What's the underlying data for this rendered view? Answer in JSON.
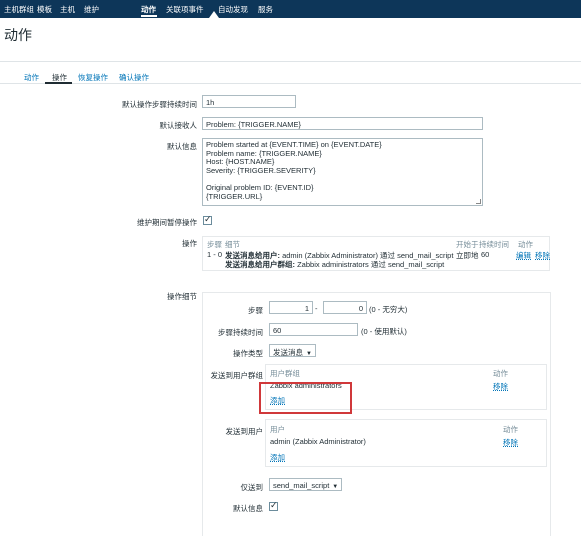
{
  "topnav": {
    "items": [
      "主机群组",
      "模板",
      "主机",
      "维护",
      "动作",
      "关联项事件",
      "自动发现",
      "服务"
    ],
    "active_index": 4
  },
  "page": {
    "title": "动作"
  },
  "tabs": {
    "items": [
      "动作",
      "操作",
      "恢复操作",
      "确认操作"
    ],
    "active_index": 1
  },
  "form": {
    "default_duration_label": "默认操作步骤持续时间",
    "default_duration_value": "1h",
    "default_subject_label": "默认接收人",
    "default_subject_value": "Problem: {TRIGGER.NAME}",
    "default_message_label": "默认信息",
    "default_message_lines": [
      "Problem started at {EVENT.TIME} on {EVENT.DATE}",
      "Problem name: {TRIGGER.NAME}",
      "Host: {HOST.NAME}",
      "Severity: {TRIGGER.SEVERITY}",
      "",
      "Original problem ID: {EVENT.ID}",
      "{TRIGGER.URL}"
    ],
    "pause_label": "维护期间暂停操作",
    "pause_checked": true
  },
  "operations": {
    "label": "操作",
    "headers": {
      "steps": "步骤",
      "details": "细节",
      "start_in": "开始于",
      "duration": "持续时间",
      "action": "动作"
    },
    "row": {
      "steps": "1 - 0",
      "line1_bold": "发送消息给用户:",
      "line1_rest": "admin (Zabbix Administrator) 通过 send_mail_script",
      "line2_bold": "发送消息给用户群组:",
      "line2_rest": "Zabbix administrators 通过 send_mail_script",
      "start_in": "立即地",
      "duration": "60",
      "edit": "编辑",
      "remove": "移除"
    }
  },
  "details": {
    "label": "操作细节",
    "step_label": "步骤",
    "step_from": "1",
    "step_dash": "-",
    "step_to": "0",
    "step_hint": "(0 - 无穷大)",
    "step_duration_label": "步骤持续时间",
    "step_duration_value": "60",
    "step_duration_hint": "(0 - 使用默认)",
    "op_type_label": "操作类型",
    "op_type_value": "发送消息",
    "groups_label": "发送到用户群组",
    "groups_header": "用户群组",
    "groups_action_header": "动作",
    "groups_row": "Zabbix administrators",
    "groups_remove": "移除",
    "groups_add": "添加",
    "users_label": "发送到用户",
    "users_header": "用户",
    "users_action_header": "动作",
    "users_row": "admin (Zabbix Administrator)",
    "users_remove": "移除",
    "users_add": "添加",
    "send_only_label": "仅送到",
    "send_only_value": "send_mail_script",
    "default_msg_label": "默认信息",
    "default_msg_checked": true
  },
  "colors": {
    "nav_bg": "#0d3659",
    "link": "#0275b8",
    "highlight": "#d0383a"
  }
}
